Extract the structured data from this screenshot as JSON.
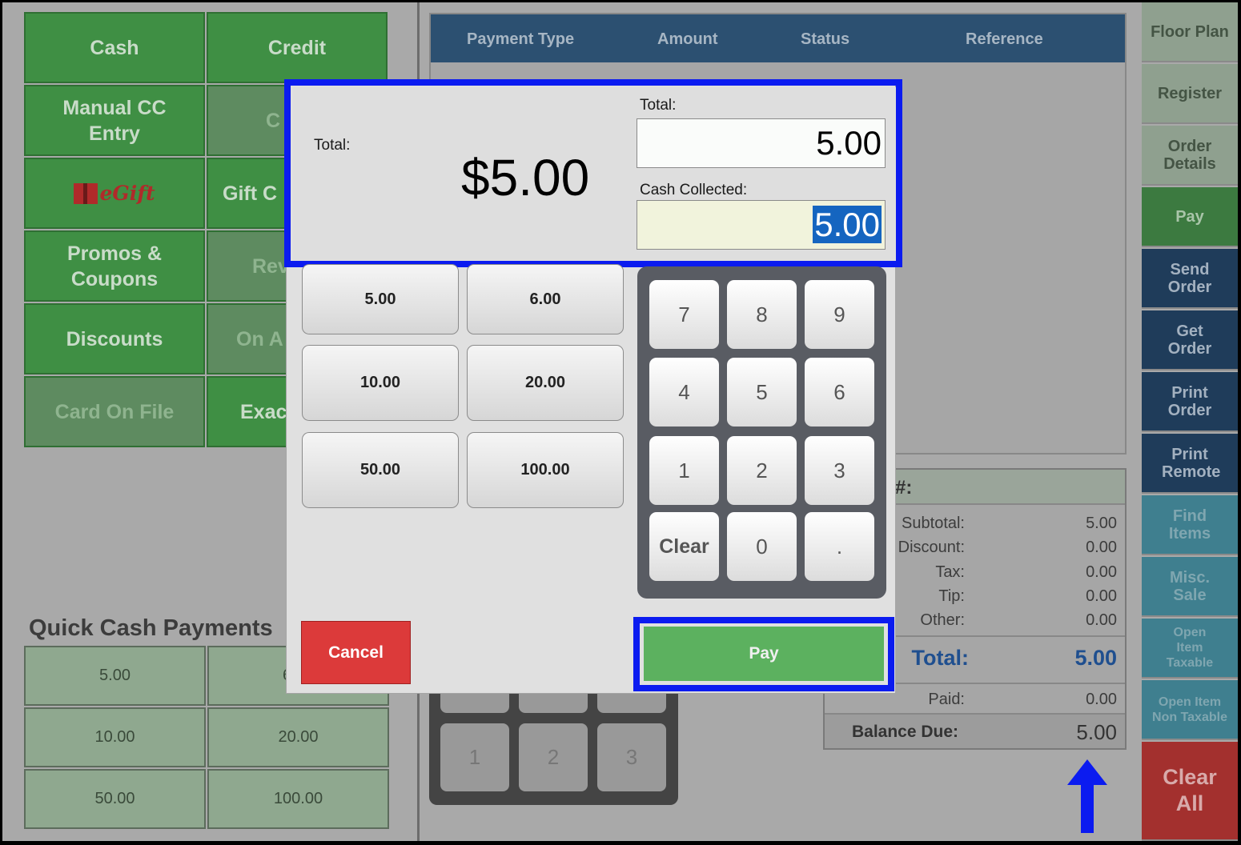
{
  "payment_types": {
    "cash": "Cash",
    "credit": "Credit",
    "manual_cc": "Manual CC Entry",
    "c_partial": "C",
    "egift": "eGift",
    "gift_card_partial": "Gift C",
    "promos": "Promos & Coupons",
    "rewards_partial": "Rev",
    "discounts": "Discounts",
    "on_account_partial": "On A",
    "card_on_file": "Card On File",
    "exact_partial": "Exac"
  },
  "quick_cash": {
    "title": "Quick Cash Payments",
    "values": [
      "5.00",
      "6",
      "10.00",
      "20.00",
      "50.00",
      "100.00"
    ]
  },
  "payments_table": {
    "headers": [
      "Payment Type",
      "Amount",
      "Status",
      "Reference"
    ]
  },
  "ghost_keypad": [
    "1",
    "2",
    "3"
  ],
  "totals": {
    "order_label": "#:",
    "subtotal_label": "Subtotal:",
    "subtotal": "5.00",
    "discount_label": "Discount:",
    "discount": "0.00",
    "tax_label": "Tax:",
    "tax": "0.00",
    "tip_label": "Tip:",
    "tip": "0.00",
    "other_label": "Other:",
    "other": "0.00",
    "total_label": "Total:",
    "total": "5.00",
    "paid_label": "Paid:",
    "paid": "0.00",
    "balance_label": "Balance Due:",
    "balance": "5.00"
  },
  "nav": {
    "floor_plan": "Floor Plan",
    "register": "Register",
    "order_details": "Order Details",
    "pay": "Pay",
    "send_order": "Send Order",
    "get_order": "Get Order",
    "print_order": "Print Order",
    "print_remote": "Print Remote",
    "find_items": "Find Items",
    "misc_sale": "Misc. Sale",
    "open_taxable": "Open Item Taxable",
    "open_non_taxable": "Open Item Non Taxable",
    "clear_all": "Clear All"
  },
  "modal": {
    "total_label": "Total:",
    "total_display": "$5.00",
    "field_total_label": "Total:",
    "field_total_value": "5.00",
    "cash_collected_label": "Cash Collected:",
    "cash_collected_value": "5.00",
    "quick_amounts": [
      "5.00",
      "6.00",
      "10.00",
      "20.00",
      "50.00",
      "100.00"
    ],
    "keypad": [
      "7",
      "8",
      "9",
      "4",
      "5",
      "6",
      "1",
      "2",
      "3",
      "Clear",
      "0",
      "."
    ],
    "cancel": "Cancel",
    "pay": "Pay"
  },
  "colors": {
    "highlight": "#0b1bf0",
    "pay_green": "#5cb15f",
    "cancel_red": "#dc3a3a"
  }
}
